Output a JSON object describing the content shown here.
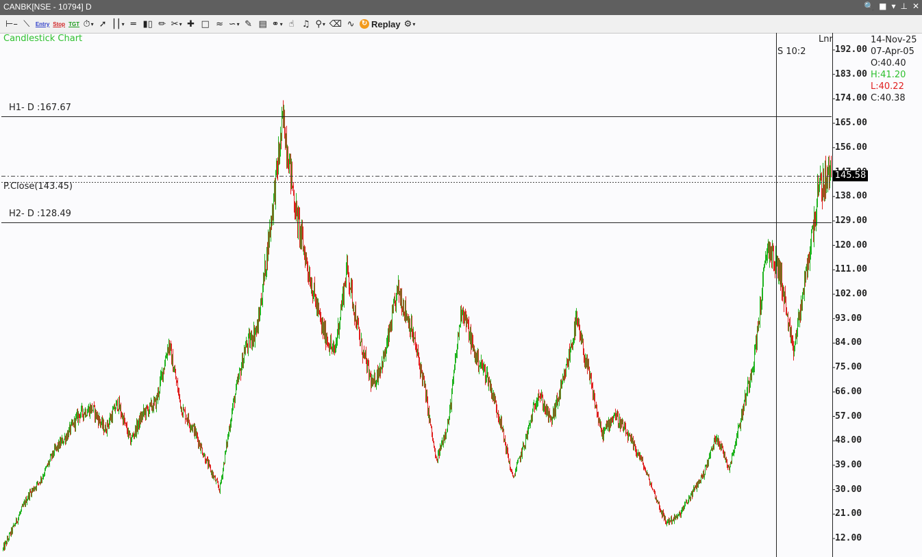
{
  "window": {
    "title": "CANBK[NSE - 10794] D"
  },
  "toolbar": {
    "entry_label": "Entry",
    "stop_label": "Stop",
    "tgt_label": "TGT",
    "replay_label": "Replay",
    "icons": [
      "line-segment-icon",
      "trendline-icon",
      "entry-icon",
      "stop-icon",
      "target-icon",
      "timer-icon",
      "pointer-icon",
      "bar-style-icon",
      "horizontal-lines-icon",
      "volume-bars-icon",
      "ruler-icon",
      "scissors-icon",
      "crosshair-cursor-icon",
      "rectangle-icon",
      "wave-icon",
      "pattern-icon",
      "chart-tools-icon",
      "script-icon",
      "link-icon",
      "pointer-hand-icon",
      "alert-bell-icon",
      "zoom-icon",
      "delete-icon",
      "compare-icon",
      "replay-icon",
      "settings-gear-icon"
    ]
  },
  "chart": {
    "title": "Candlestick Chart",
    "h1_label": "H1- D :167.67",
    "h2_label": "H2- D :128.49",
    "pclose_label": "P.Close(143.45)",
    "session_label": "S 10:2",
    "lnr_label": "Lnr",
    "current_price": "145.58",
    "y_ticks": [
      "192.00",
      "183.00",
      "174.00",
      "165.00",
      "156.00",
      "147.00",
      "138.00",
      "129.00",
      "120.00",
      "111.00",
      "102.00",
      "93.00",
      "84.00",
      "75.00",
      "66.00",
      "57.00",
      "48.00",
      "39.00",
      "30.00",
      "21.00",
      "12.00"
    ]
  },
  "info": {
    "date": "14-Nov-25",
    "bar_date": "07-Apr-05",
    "open": "O:40.40",
    "high": "H:41.20",
    "low": "L:40.22",
    "close": "C:40.38"
  },
  "chart_data": {
    "type": "candlestick",
    "title": "Candlestick Chart",
    "ylim": [
      6,
      198
    ],
    "y_ticks": [
      192,
      183,
      174,
      165,
      156,
      147,
      138,
      129,
      120,
      111,
      102,
      93,
      84,
      75,
      66,
      57,
      48,
      39,
      30,
      21,
      12
    ],
    "h1": 167.67,
    "h2": 128.49,
    "prev_close": 143.45,
    "last": 145.58,
    "colors": {
      "up": "#1fb31f",
      "down": "#e01e1e"
    },
    "trend": [
      8,
      18,
      28,
      34,
      44,
      50,
      58,
      60,
      52,
      62,
      48,
      58,
      62,
      84,
      60,
      52,
      40,
      30,
      60,
      82,
      90,
      128,
      167,
      132,
      110,
      90,
      80,
      112,
      85,
      68,
      80,
      104,
      90,
      70,
      40,
      56,
      98,
      80,
      72,
      56,
      34,
      48,
      66,
      55,
      70,
      92,
      72,
      50,
      58,
      50,
      42,
      30,
      18,
      20,
      28,
      36,
      50,
      38,
      58,
      80,
      120,
      110,
      80,
      108,
      140,
      147
    ]
  }
}
